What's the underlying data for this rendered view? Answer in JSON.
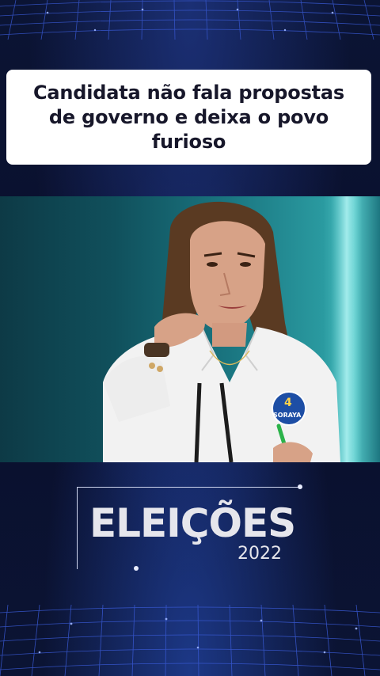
{
  "headline": {
    "text": "Candidata não fala propostas de governo e deixa o povo furioso"
  },
  "video": {
    "subject": "woman-pointing-at-podium",
    "badge_text": "SORAYA",
    "badge_number": "4"
  },
  "brand": {
    "title": "ELEIÇÕES",
    "year": "2022"
  },
  "colors": {
    "background": "#0a1030",
    "grid": "#3a5bd8",
    "card": "#ffffff",
    "headline_text": "#17172a",
    "logo_text": "#e6e6ec"
  }
}
